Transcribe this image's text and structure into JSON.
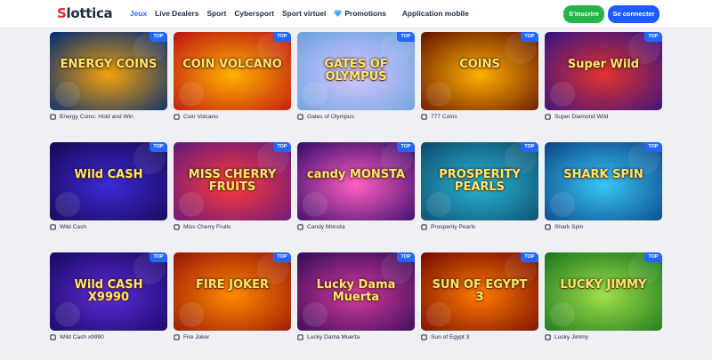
{
  "header": {
    "logo_first": "S",
    "logo_rest": "lottica",
    "nav": [
      "Jeux",
      "Live Dealers",
      "Sport",
      "Cybersport",
      "Sport virtuel",
      "Promotions",
      "Application mobile"
    ],
    "signup_label": "S'inscrire",
    "login_label": "Se connecter"
  },
  "badge_label": "TOP",
  "games": [
    {
      "title": "Energy Coins: Hold and Win",
      "art": "ENERGY COINS",
      "bg1": "#0b2f6e",
      "bg2": "#f2a10c",
      "icon": "provider-icon"
    },
    {
      "title": "Coin Volcano",
      "art": "COIN VOLCANO",
      "bg1": "#c01a12",
      "bg2": "#ffb200",
      "icon": "provider-icon"
    },
    {
      "title": "Gates of Olympus",
      "art": "GATES OF OLYMPUS",
      "bg1": "#6fa3df",
      "bg2": "#d7c7ff",
      "icon": "provider-icon"
    },
    {
      "title": "777 Coins",
      "art": "COINS",
      "bg1": "#6b1a00",
      "bg2": "#ffb000",
      "icon": "provider-icon"
    },
    {
      "title": "Super Diamond Wild",
      "art": "Super Wild",
      "bg1": "#3d1480",
      "bg2": "#e2332b",
      "icon": "provider-icon"
    },
    {
      "title": "Wild Cash",
      "art": "Wild CASH",
      "bg1": "#1a0a5a",
      "bg2": "#3b2ad6",
      "icon": "provider-icon"
    },
    {
      "title": "Miss Cherry Fruits",
      "art": "MISS CHERRY FRUITS",
      "bg1": "#6a1a7a",
      "bg2": "#ff3a3a",
      "icon": "provider-icon"
    },
    {
      "title": "Candy Monsta",
      "art": "candy MONSTA",
      "bg1": "#3c0f6e",
      "bg2": "#ff5fc0",
      "icon": "provider-icon"
    },
    {
      "title": "Prosperity Pearls",
      "art": "PROSPERITY PEARLS",
      "bg1": "#0f4f6f",
      "bg2": "#29b6d6",
      "icon": "provider-icon"
    },
    {
      "title": "Shark Spin",
      "art": "SHARK SPIN",
      "bg1": "#0d4a8c",
      "bg2": "#38c6f4",
      "icon": "provider-icon"
    },
    {
      "title": "Wild Cash x9990",
      "art": "Wild CASH X9990",
      "bg1": "#1c0a66",
      "bg2": "#5b2bd8",
      "icon": "provider-icon"
    },
    {
      "title": "Fire Joker",
      "art": "FIRE JOKER",
      "bg1": "#9a1a08",
      "bg2": "#ff8a00",
      "icon": "provider-icon"
    },
    {
      "title": "Lucky Dama Muerta",
      "art": "Lucky Dama Muerta",
      "bg1": "#3a0d5a",
      "bg2": "#d63aa0",
      "icon": "provider-icon"
    },
    {
      "title": "Sun of Egypt 3",
      "art": "SUN OF EGYPT 3",
      "bg1": "#7a0f00",
      "bg2": "#ff7a00",
      "icon": "provider-icon"
    },
    {
      "title": "Lucky Jimmy",
      "art": "LUCKY JIMMY",
      "bg1": "#1f7a1f",
      "bg2": "#9fe04a",
      "icon": "provider-icon"
    }
  ],
  "colors": {
    "accent": "#1e6cff",
    "signup": "#25b34a",
    "login": "#1e5bff",
    "badge": "#2266ff",
    "logo_red": "#e6262f"
  }
}
